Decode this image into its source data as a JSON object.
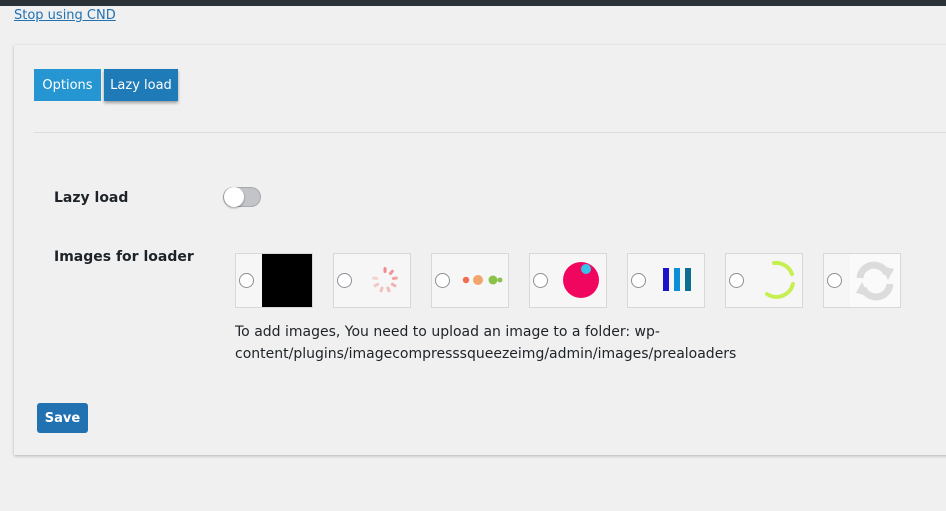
{
  "top_link": "Stop using CND",
  "tabs": [
    {
      "label": "Options"
    },
    {
      "label": "Lazy load"
    }
  ],
  "settings": {
    "lazy_load_label": "Lazy load",
    "lazy_load_enabled": false,
    "images_label": "Images for loader"
  },
  "loaders": [
    {
      "icon": "black-square-icon",
      "selected": false
    },
    {
      "icon": "spinner-dots-icon",
      "selected": false
    },
    {
      "icon": "three-dots-icon",
      "selected": false
    },
    {
      "icon": "pink-circle-icon",
      "selected": false
    },
    {
      "icon": "bars-icon",
      "selected": false
    },
    {
      "icon": "arc-spinner-icon",
      "selected": false
    },
    {
      "icon": "refresh-arrows-icon",
      "selected": false
    }
  ],
  "note": "To add images, You need to upload an image to a folder: wp-content/plugins/imagecompresssqueezeimg/admin/images/prealoaders",
  "save_label": "Save",
  "colors": {
    "accent": "#2271b1",
    "tab_options": "#2596d1",
    "tab_active": "#1f7ab8"
  }
}
